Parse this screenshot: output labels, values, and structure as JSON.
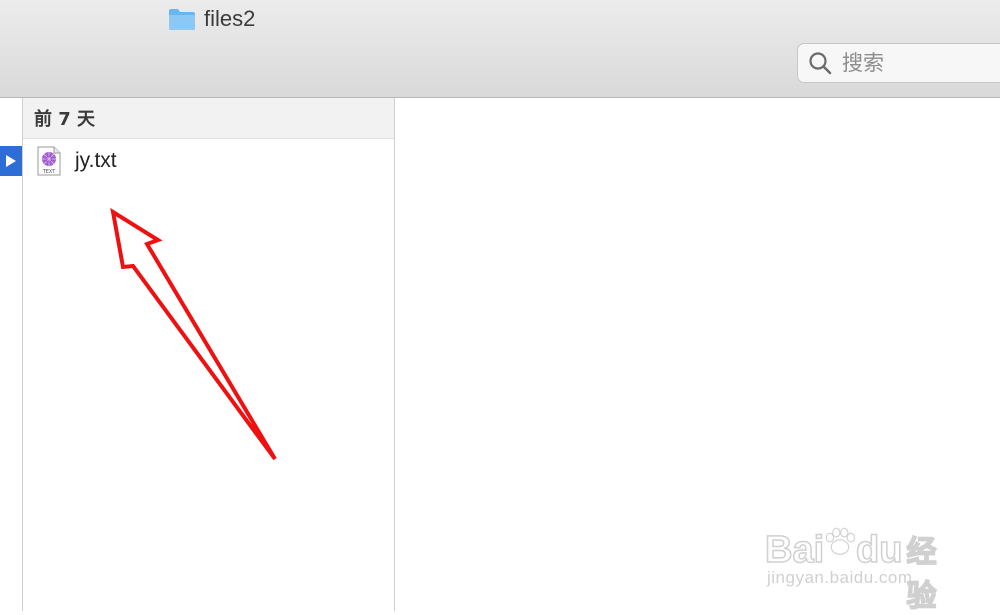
{
  "window": {
    "title": "files2",
    "icon": "folder-icon"
  },
  "search": {
    "placeholder": "搜索",
    "icon": "search-icon"
  },
  "column": {
    "group_header": "前 7 天",
    "items": [
      {
        "name": "jy.txt",
        "icon": "text-file-icon",
        "icon_badge": "TEXT"
      }
    ]
  },
  "annotation": {
    "arrow_color": "#ee1111"
  },
  "watermark": {
    "logo_part1": "Bai",
    "logo_part2": "du",
    "logo_suffix": "经验",
    "url": "jingyan.baidu.com"
  },
  "colors": {
    "selection_blue": "#2d6ed6",
    "folder_blue": "#6cb6f0"
  }
}
